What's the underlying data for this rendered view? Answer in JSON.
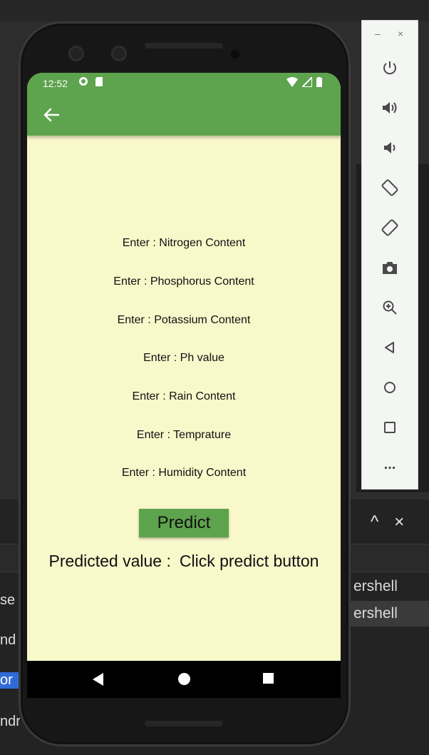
{
  "status_bar": {
    "time": "12:52"
  },
  "app": {
    "fields": [
      "Enter : Nitrogen Content",
      "Enter : Phosphorus Content",
      "Enter : Potassium Content",
      "Enter : Ph value",
      "Enter : Rain Content",
      "Enter : Temprature",
      "Enter : Humidity Content"
    ],
    "predict_label": "Predict",
    "result_label": "Predicted value :",
    "result_value": "Click predict button"
  },
  "emulator_toolbar": {
    "window_controls": [
      "–",
      "×"
    ],
    "buttons": [
      "power-icon",
      "volume-up-icon",
      "volume-down-icon",
      "rotate-left-icon",
      "rotate-right-icon",
      "camera-icon",
      "zoom-icon",
      "back-icon",
      "home-icon",
      "overview-icon",
      "more-icon"
    ],
    "more_label": "..."
  },
  "ide": {
    "panel_controls": [
      "^",
      "×"
    ],
    "terminal_rows": [
      "ershell",
      "ershell"
    ],
    "left_fragments": [
      "se",
      "nd",
      "or",
      "ndr"
    ]
  },
  "colors": {
    "app_bar": "#5ea34d",
    "screen_bg": "#f9f8cb",
    "predict_button": "#5ea34d"
  }
}
